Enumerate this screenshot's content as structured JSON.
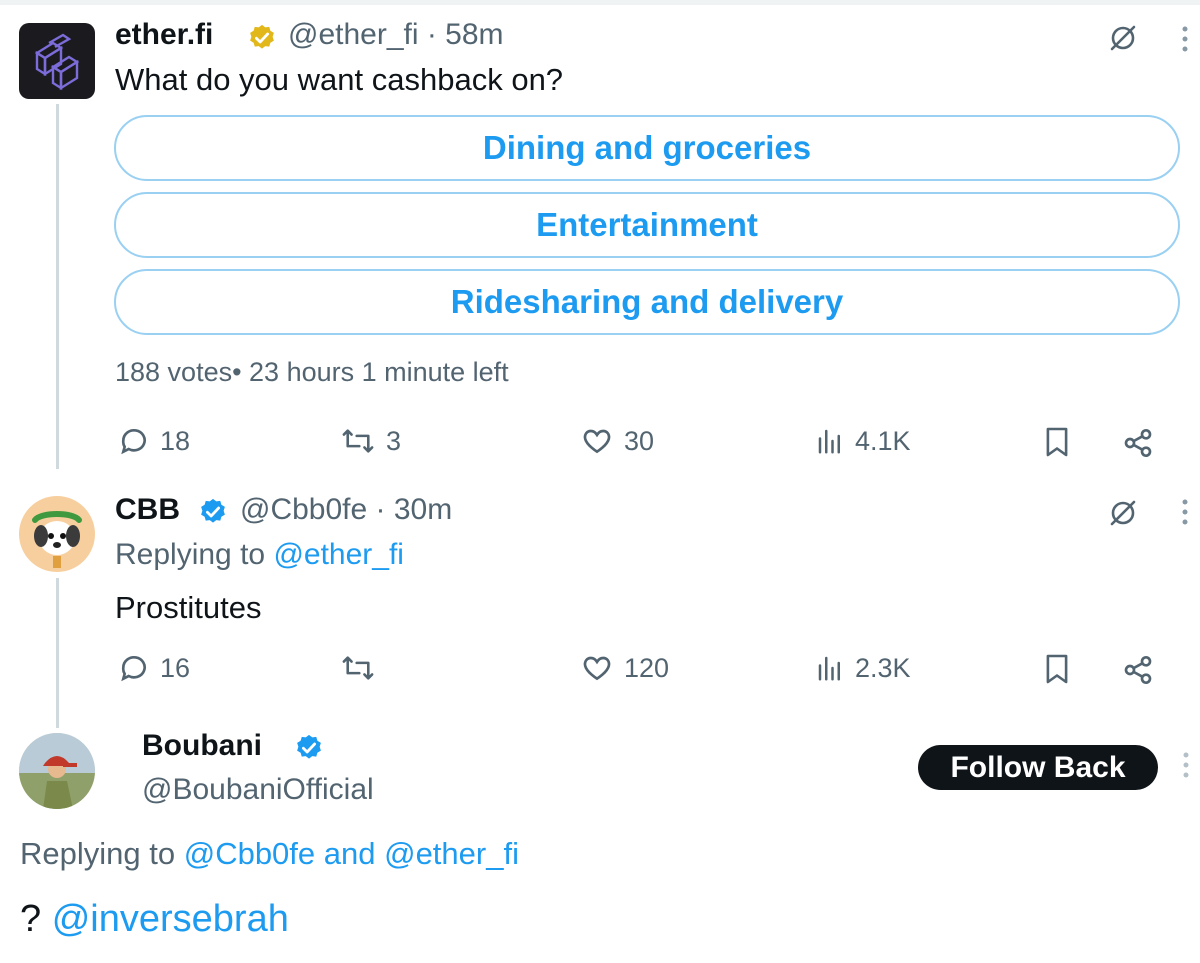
{
  "tweet1": {
    "name": "ether.fi",
    "handle_time": "@ether_fi · 58m",
    "text": "What do you want cashback on?",
    "poll": {
      "options": [
        "Dining and groceries",
        "Entertainment",
        "Ridesharing and delivery"
      ],
      "meta": "188 votes• 23 hours 1 minute left"
    },
    "actions": {
      "replies": "18",
      "reposts": "3",
      "likes": "30",
      "views": "4.1K"
    },
    "verified_color": "#e2b719"
  },
  "tweet2": {
    "name": "CBB",
    "handle_time": "@Cbb0fe · 30m",
    "replying_prefix": "Replying to",
    "replying_handle": "@ether_fi",
    "text": "Prostitutes",
    "actions": {
      "replies": "16",
      "reposts": "",
      "likes": "120",
      "views": "2.3K"
    },
    "verified_color": "#1d9bf0"
  },
  "tweet3": {
    "name": "Boubani",
    "handle": "@BoubaniOfficial",
    "follow_label": "Follow Back",
    "replying_prefix": "Replying to",
    "replying_handles": "@Cbb0fe and @ether_fi",
    "text_prefix": "?",
    "mention": "@inversebrah",
    "verified_color": "#1d9bf0"
  },
  "icons": {
    "grok": "grok-slash-icon",
    "more": "more-vertical-icon",
    "reply": "comment-icon",
    "repost": "repost-icon",
    "like": "heart-icon",
    "views": "bar-chart-icon",
    "bookmark": "bookmark-icon",
    "share": "share-icon"
  },
  "colors": {
    "accent": "#1d9bf0",
    "muted": "#536471",
    "text": "#0f1419"
  }
}
